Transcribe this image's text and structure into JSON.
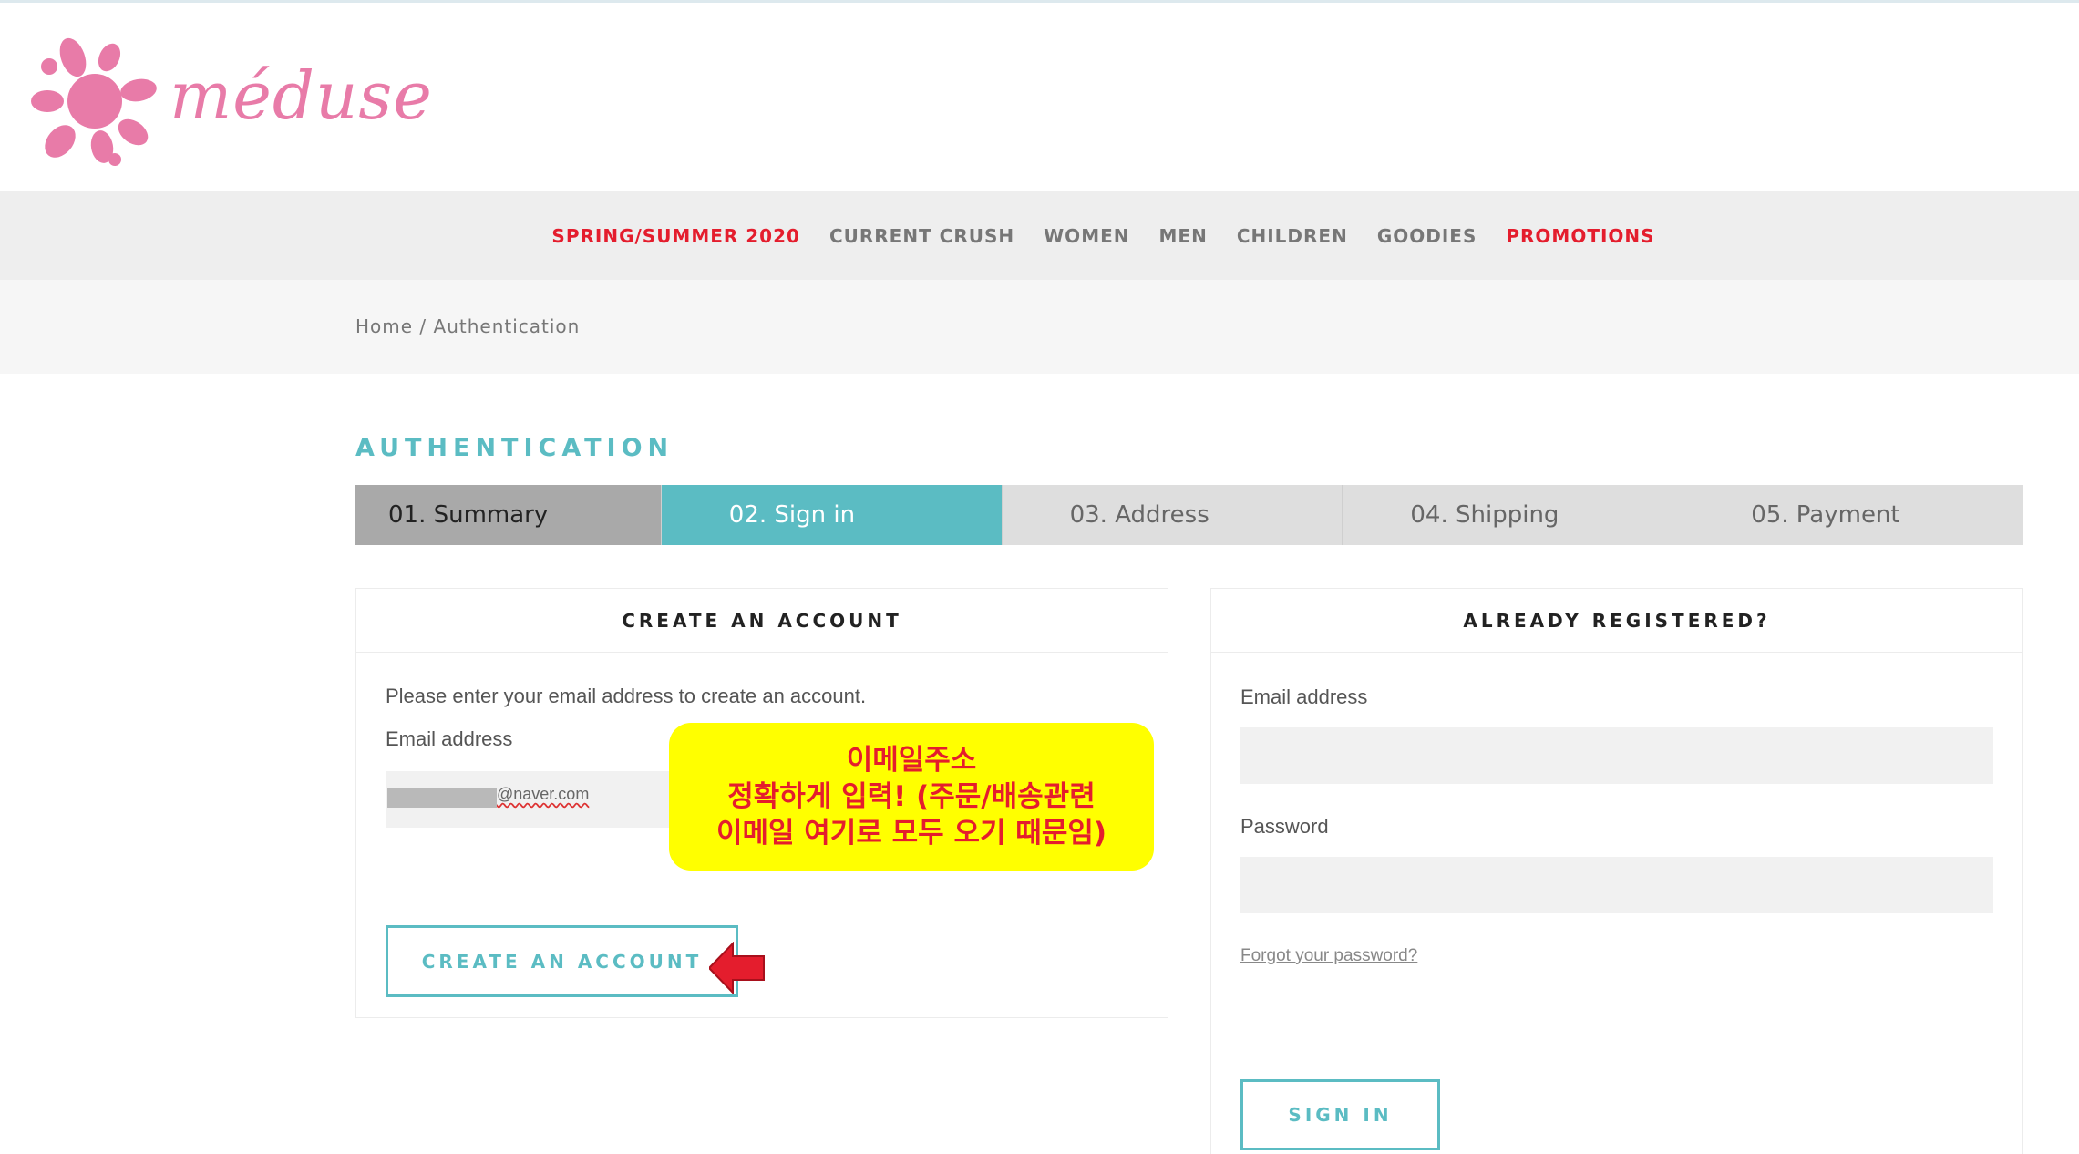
{
  "brand": {
    "name": "méduse",
    "color": "#e87ba8"
  },
  "nav": {
    "items": [
      {
        "label": "SPRING/SUMMER 2020",
        "highlight": true
      },
      {
        "label": "CURRENT CRUSH",
        "highlight": false
      },
      {
        "label": "WOMEN",
        "highlight": false
      },
      {
        "label": "MEN",
        "highlight": false
      },
      {
        "label": "CHILDREN",
        "highlight": false
      },
      {
        "label": "GOODIES",
        "highlight": false
      },
      {
        "label": "PROMOTIONS",
        "highlight": true
      }
    ]
  },
  "breadcrumb": {
    "home": "Home",
    "separator": " / ",
    "current": "Authentication"
  },
  "page": {
    "title": "AUTHENTICATION"
  },
  "steps": [
    {
      "label": "01. Summary",
      "state": "done"
    },
    {
      "label": "02. Sign in",
      "state": "active"
    },
    {
      "label": "03. Address",
      "state": "pending"
    },
    {
      "label": "04. Shipping",
      "state": "pending"
    },
    {
      "label": "05. Payment",
      "state": "pending"
    }
  ],
  "create_account": {
    "heading": "CREATE AN ACCOUNT",
    "intro": "Please enter your email address to create an account.",
    "email_label": "Email address",
    "email_value": "@naver.com",
    "button": "CREATE AN ACCOUNT"
  },
  "login": {
    "heading": "ALREADY REGISTERED?",
    "email_label": "Email address",
    "email_value": "",
    "password_label": "Password",
    "password_value": "",
    "forgot": "Forgot your password?",
    "button": "SIGN IN"
  },
  "annotation": {
    "lines": [
      "이메일주소",
      "정확하게 입력! (주문/배송관련",
      "이메일 여기로 모두 오기 때문임)"
    ]
  },
  "colors": {
    "accent": "#5bbcc3",
    "nav_highlight": "#e41d2d",
    "callout_bg": "#ffff00",
    "callout_text": "#e41d2d"
  }
}
